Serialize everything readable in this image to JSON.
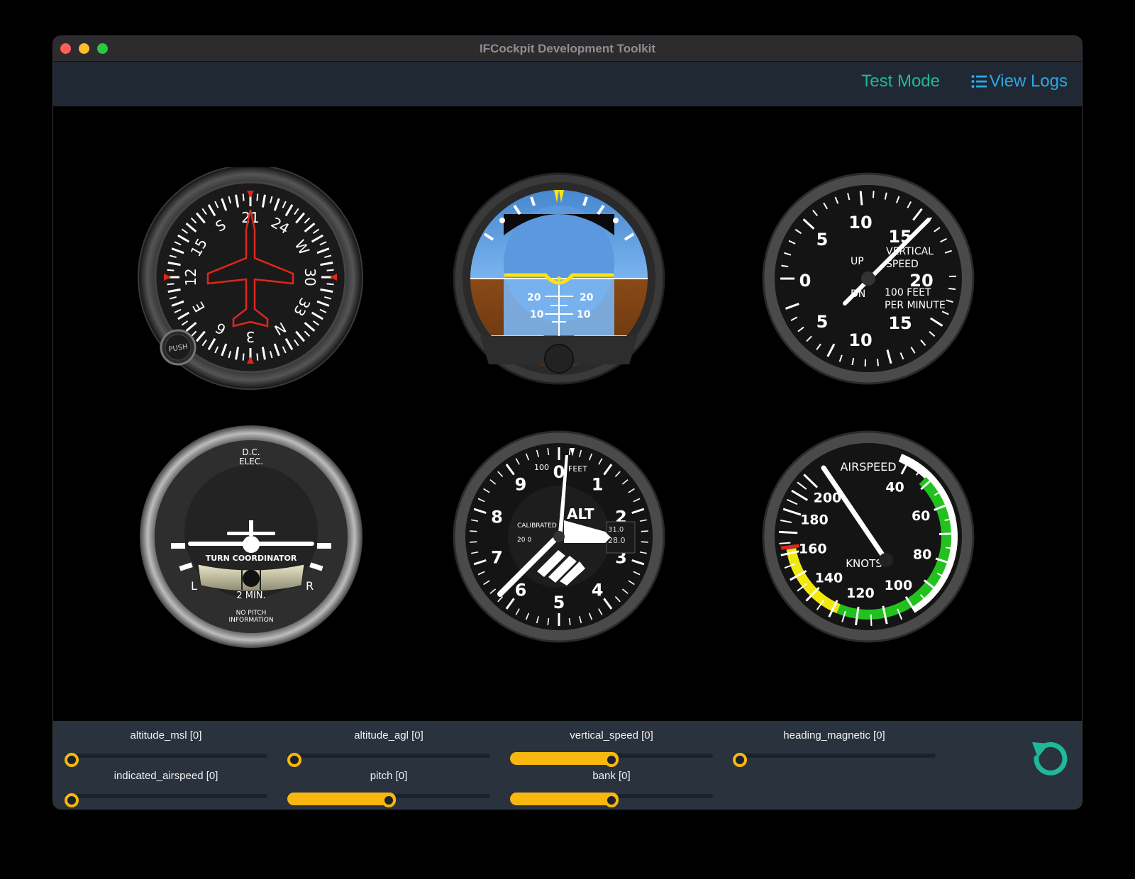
{
  "window": {
    "title": "IFCockpit Development Toolkit"
  },
  "navbar": {
    "test_mode": "Test Mode",
    "view_logs": "View Logs",
    "test_mode_color": "#1fb89a",
    "view_logs_color": "#2ba8e6"
  },
  "heading": {
    "compass_labels": [
      "N",
      "3",
      "6",
      "E",
      "12",
      "15",
      "S",
      "21",
      "24",
      "W",
      "30",
      "33"
    ],
    "push_label": "PUSH"
  },
  "attitude": {
    "pitch_marks_20": "20",
    "pitch_marks_10": "10"
  },
  "vsi": {
    "labels": {
      "up": "UP",
      "dn": "DN",
      "title_1": "VERTICAL",
      "title_2": "SPEED",
      "units_1": "100 FEET",
      "units_2": "PER MINUTE"
    },
    "numbers": [
      "0",
      "5",
      "10",
      "15",
      "20",
      "15",
      "10",
      "5"
    ]
  },
  "turn": {
    "top_1": "D.C.",
    "top_2": "ELEC.",
    "title": "TURN COORDINATOR",
    "left": "L",
    "right": "R",
    "minutes": "2 MIN.",
    "bottom_1": "NO PITCH",
    "bottom_2": "INFORMATION"
  },
  "altimeter": {
    "numbers": [
      "0",
      "1",
      "2",
      "3",
      "4",
      "5",
      "6",
      "7",
      "8",
      "9"
    ],
    "label_100": "100",
    "label_feet": "FEET",
    "label_alt": "ALT",
    "label_calibrated": "CALIBRATED",
    "label_200": "20 0",
    "kollsman": [
      "31.0",
      "28.0"
    ]
  },
  "airspeed": {
    "title": "AIRSPEED",
    "units": "KNOTS",
    "numbers": [
      "40",
      "60",
      "80",
      "100",
      "120",
      "140",
      "160",
      "180",
      "200"
    ]
  },
  "sliders": [
    {
      "label": "altitude_msl [0]",
      "value": 0
    },
    {
      "label": "altitude_agl [0]",
      "value": 0
    },
    {
      "label": "vertical_speed [0]",
      "value": 0.5
    },
    {
      "label": "heading_magnetic [0]",
      "value": 0
    },
    {
      "label": "indicated_airspeed [0]",
      "value": 0
    },
    {
      "label": "pitch [0]",
      "value": 0.5
    },
    {
      "label": "bank [0]",
      "value": 0.5
    }
  ],
  "colors": {
    "accent": "#f7b70f",
    "reset": "#1fb89a"
  },
  "icons": {
    "logs": "list-icon",
    "reset": "reset-icon"
  }
}
